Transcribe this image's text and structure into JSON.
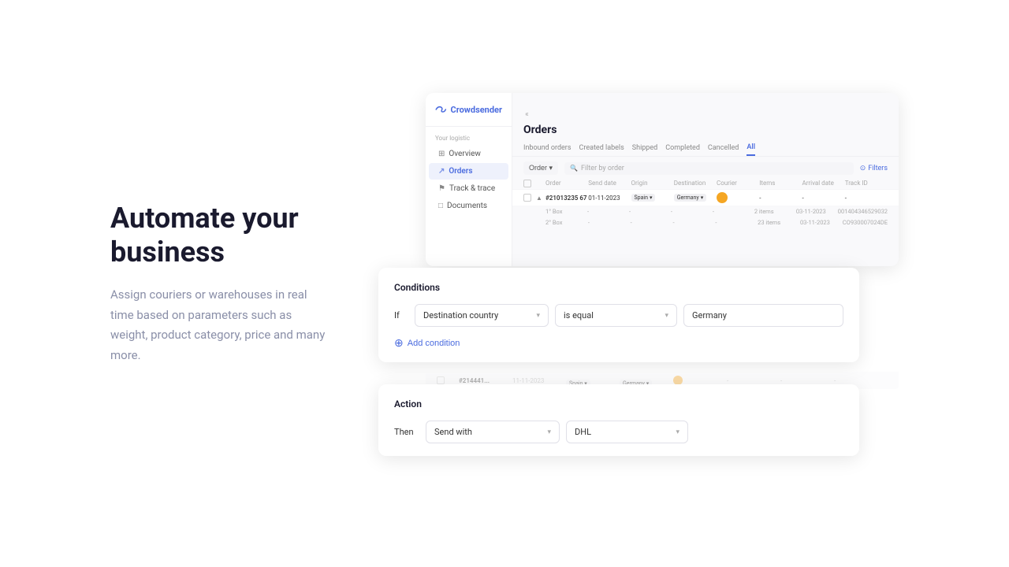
{
  "left": {
    "heading": "Automate your business",
    "subtext": "Assign couriers or warehouses in real time based on parameters such as weight, product category, price and many more."
  },
  "app": {
    "brand": "Crowdsender",
    "collapse_btn": "«",
    "page_title": "Orders",
    "sidebar_section": "Your logistic",
    "sidebar_items": [
      {
        "label": "Overview",
        "icon": "⊞",
        "active": false
      },
      {
        "label": "Orders",
        "icon": "↗",
        "active": true
      },
      {
        "label": "Track & trace",
        "icon": "⚑",
        "active": false
      },
      {
        "label": "Documents",
        "icon": "□",
        "active": false
      }
    ],
    "tabs": [
      {
        "label": "Inbound orders",
        "active": false
      },
      {
        "label": "Created labels",
        "active": false
      },
      {
        "label": "Shipped",
        "active": false
      },
      {
        "label": "Completed",
        "active": false
      },
      {
        "label": "Cancelled",
        "active": false
      },
      {
        "label": "All",
        "active": true
      }
    ],
    "toolbar": {
      "order_btn": "Order ▾",
      "search_placeholder": "Filter by order",
      "filters_btn": "Filters"
    },
    "table_headers": [
      "Order",
      "Send date",
      "Origin",
      "Destination",
      "Courier",
      "Items",
      "Arrival date",
      "Track ID"
    ],
    "rows": [
      {
        "id": "#21013235 67",
        "send_date": "01-11-2023",
        "origin": "Spain",
        "destination": "Germany",
        "courier": "●",
        "items": "-",
        "arrival_date": "-",
        "track_id": "-"
      }
    ],
    "sub_rows": [
      {
        "box": "1° Box",
        "send_date": "-",
        "origin": "-",
        "destination": "-",
        "courier": "-",
        "items": "2 items",
        "arrival_date": "03-11-2023",
        "track_id": "001404346529032"
      },
      {
        "box": "2° Box",
        "send_date": "-",
        "origin": "-",
        "destination": "-",
        "courier": "-",
        "items": "23 items",
        "arrival_date": "03-11-2023",
        "track_id": "CO930007024DE"
      }
    ]
  },
  "conditions_card": {
    "title": "Conditions",
    "if_label": "If",
    "field_label": "Destination country",
    "operator_label": "is equal",
    "value": "Germany",
    "add_condition_label": "Add condition",
    "field_arrow": "▾",
    "operator_arrow": "▾"
  },
  "action_card": {
    "title": "Action",
    "then_label": "Then",
    "action_label": "Send with",
    "action_arrow": "▾",
    "target_label": "DHL",
    "target_arrow": "▾"
  }
}
